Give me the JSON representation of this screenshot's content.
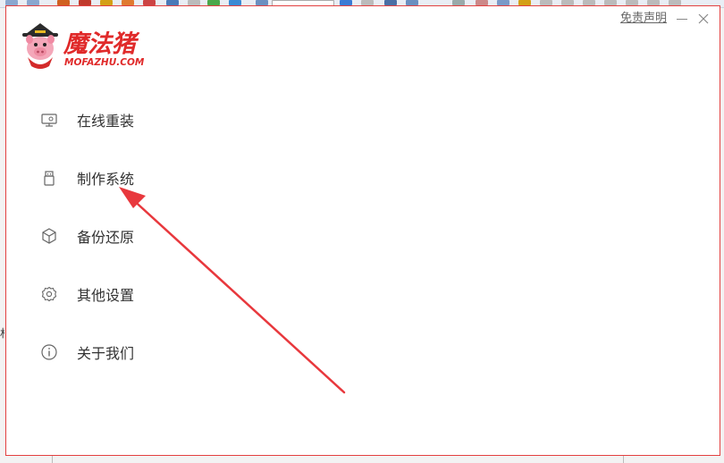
{
  "app": {
    "logo_cn": "魔法猪",
    "logo_en": "MOFAZHU.COM",
    "brand_color": "#e02a2a"
  },
  "titlebar": {
    "disclaimer_label": "免责声明",
    "minimize_icon": "minimize-icon",
    "close_icon": "close-icon"
  },
  "menu": {
    "items": [
      {
        "label": "在线重装",
        "icon": "monitor-icon"
      },
      {
        "label": "制作系统",
        "icon": "usb-drive-icon"
      },
      {
        "label": "备份还原",
        "icon": "backup-box-icon"
      },
      {
        "label": "其他设置",
        "icon": "gear-icon"
      },
      {
        "label": "关于我们",
        "icon": "info-icon"
      }
    ]
  },
  "annotation": {
    "type": "arrow",
    "color": "#e8383d",
    "points_to": "制作系统"
  }
}
